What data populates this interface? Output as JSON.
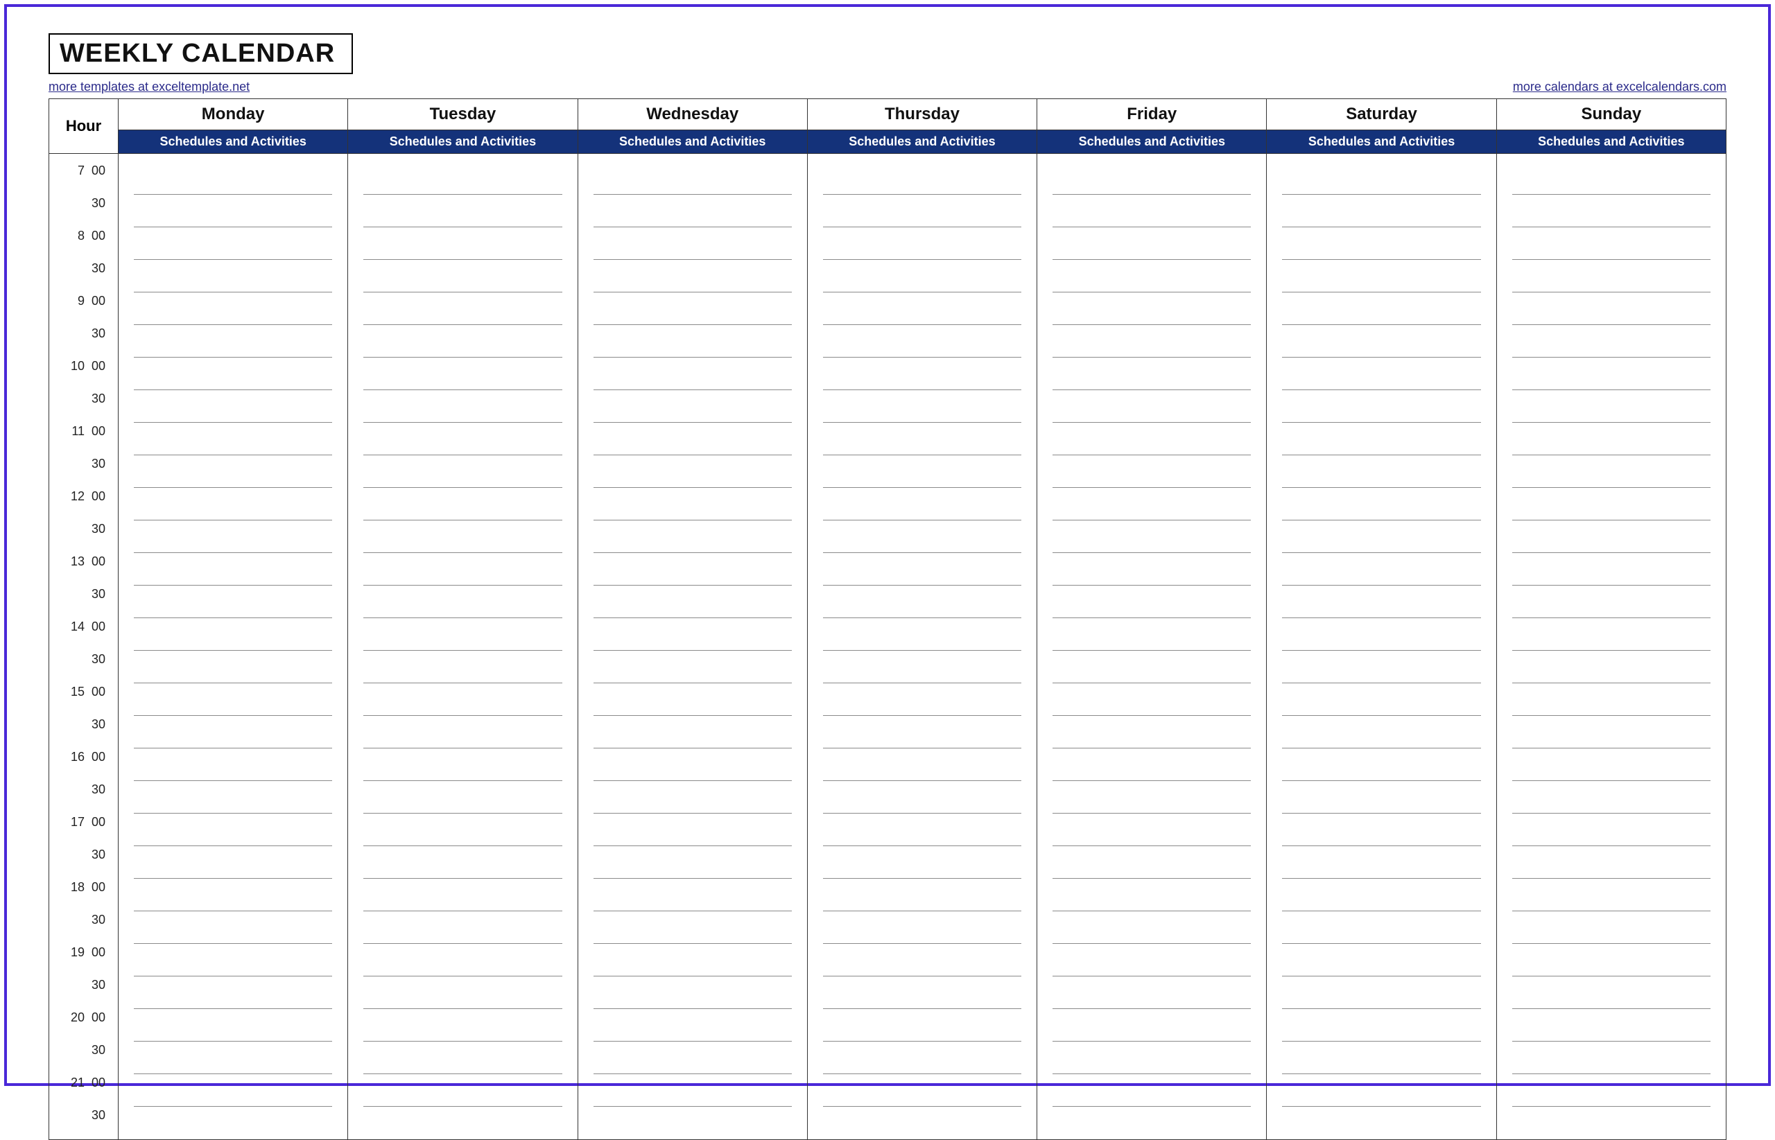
{
  "title": "WEEKLY CALENDAR",
  "links": {
    "left": "more templates at exceltemplate.net",
    "right": "more calendars at excelcalendars.com"
  },
  "header": {
    "hour_label": "Hour",
    "sub_label": "Schedules and Activities",
    "days": [
      "Monday",
      "Tuesday",
      "Wednesday",
      "Thursday",
      "Friday",
      "Saturday",
      "Sunday"
    ]
  },
  "time_slots": [
    {
      "hour": "7",
      "min": "00"
    },
    {
      "hour": "",
      "min": "30"
    },
    {
      "hour": "8",
      "min": "00"
    },
    {
      "hour": "",
      "min": "30"
    },
    {
      "hour": "9",
      "min": "00"
    },
    {
      "hour": "",
      "min": "30"
    },
    {
      "hour": "10",
      "min": "00"
    },
    {
      "hour": "",
      "min": "30"
    },
    {
      "hour": "11",
      "min": "00"
    },
    {
      "hour": "",
      "min": "30"
    },
    {
      "hour": "12",
      "min": "00"
    },
    {
      "hour": "",
      "min": "30"
    },
    {
      "hour": "13",
      "min": "00"
    },
    {
      "hour": "",
      "min": "30"
    },
    {
      "hour": "14",
      "min": "00"
    },
    {
      "hour": "",
      "min": "30"
    },
    {
      "hour": "15",
      "min": "00"
    },
    {
      "hour": "",
      "min": "30"
    },
    {
      "hour": "16",
      "min": "00"
    },
    {
      "hour": "",
      "min": "30"
    },
    {
      "hour": "17",
      "min": "00"
    },
    {
      "hour": "",
      "min": "30"
    },
    {
      "hour": "18",
      "min": "00"
    },
    {
      "hour": "",
      "min": "30"
    },
    {
      "hour": "19",
      "min": "00"
    },
    {
      "hour": "",
      "min": "30"
    },
    {
      "hour": "20",
      "min": "00"
    },
    {
      "hour": "",
      "min": "30"
    },
    {
      "hour": "21",
      "min": "00"
    },
    {
      "hour": "",
      "min": "30"
    }
  ],
  "colors": {
    "frame_border": "#4a28d8",
    "header_band": "#14327a"
  }
}
